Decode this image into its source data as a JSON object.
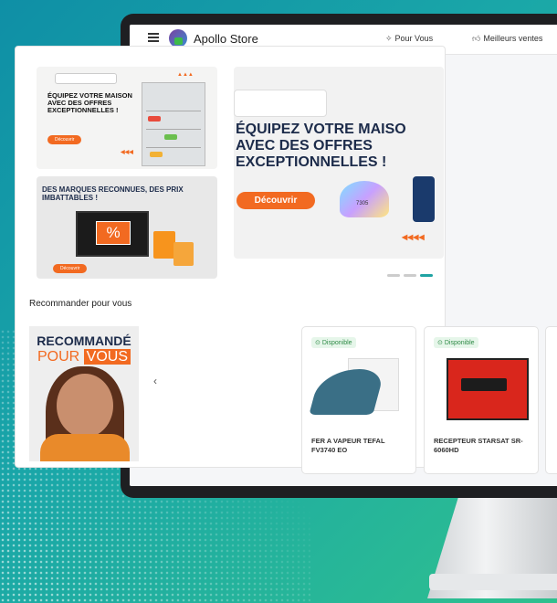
{
  "app": {
    "name": "Apollo Store"
  },
  "nav": {
    "links": [
      {
        "icon": "sparkle-icon",
        "label": "Pour Vous"
      },
      {
        "icon": "thumbs-up-icon",
        "label": "Meilleurs ventes"
      }
    ]
  },
  "banners": {
    "small1": {
      "title": "ÉQUIPEZ VOTRE MAISON AVEC DES OFFRES EXCEPTIONNELLES !",
      "button": "Découvrir"
    },
    "small2": {
      "title": "DES MARQUES RECONNUES, DES PRIX IMBATTABLES !",
      "percent": "%",
      "button": "Découvrir"
    },
    "large": {
      "title_line1": "ÉQUIPEZ VOTRE MAISO",
      "title_line2": "AVEC DES OFFRES",
      "title_line3": "EXCEPTIONNELLES !",
      "button": "Découvrir",
      "clock": "7305"
    }
  },
  "recommend": {
    "section_title": "Recommander pour vous",
    "promo_line1": "RECOMMANDÉ",
    "promo_line2a": "POUR",
    "promo_line2b": "VOUS",
    "prev_icon": "‹",
    "products": [
      {
        "badge": "Disponible",
        "name": "FER A VAPEUR TEFAL FV3740 EO"
      },
      {
        "badge": "Disponible",
        "name": "RECEPTEUR STARSAT SR-6060HD"
      }
    ]
  },
  "colors": {
    "accent": "#f26a21",
    "brand_navy": "#1c2b4a",
    "teal": "#1aa7a8"
  }
}
